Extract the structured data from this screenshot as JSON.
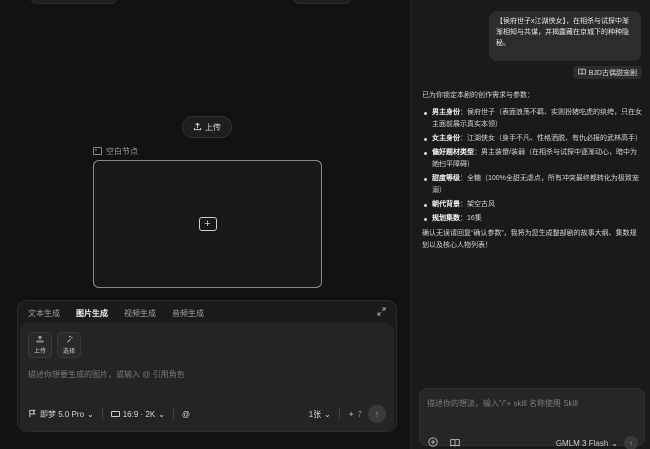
{
  "canvas": {
    "upload_label": "上传",
    "node_label": "空白节点"
  },
  "gen_panel": {
    "tabs": [
      {
        "label": "文本生成",
        "active": false
      },
      {
        "label": "图片生成",
        "active": true
      },
      {
        "label": "视频生成",
        "active": false
      },
      {
        "label": "音频生成",
        "active": false
      }
    ],
    "tools": [
      {
        "label": "上传",
        "icon": "upload-icon"
      },
      {
        "label": "选择",
        "icon": "sparkle-select-icon"
      }
    ],
    "prompt_placeholder": "描述你想要生成的图片，或输入 @ 引用角色",
    "model": "即梦 5.0 Pro",
    "ratio": "16:9 · 2K",
    "count": "1张",
    "credits": "7"
  },
  "chat": {
    "user_message": "【侯府世子x江湖侠女】，在相杀与试探中渐渐相知与共谋，并揭露藏在京城下的种种隐秘。",
    "skill_chip": "BJD古偶甜宠剧",
    "reply": {
      "intro": "已为你锁定本剧的创作需求与参数：",
      "items": [
        {
          "key": "男主身份",
          "value": "：侯府世子（表面浪荡不羁、实则扮猪吃虎的纨绔，只在女主面前展示真实本领）"
        },
        {
          "key": "女主身份",
          "value": "：江湖侠女（身手不凡、性格洒脱、有仇必报的武林高手）"
        },
        {
          "key": "偏好题材类型",
          "value": "：男主装傻/装弱（在相杀与试探中逐渐动心，暗中为她扫平障碍）"
        },
        {
          "key": "甜度等级",
          "value": "：全糖（100%全甜无虐点，所有冲突最终都转化为极致宠溺）"
        },
        {
          "key": "朝代背景",
          "value": "：架空古风"
        },
        {
          "key": "规划集数",
          "value": "：16集"
        }
      ],
      "closing": "确认无误请回复“确认参数”，我将为您生成整部剧的故事大纲、集数规划以及核心人物列表！"
    },
    "input_placeholder": "描述你的想法，输入“/”+ skill 名称使用 Skill",
    "model": "GMLM 3 Flash"
  }
}
